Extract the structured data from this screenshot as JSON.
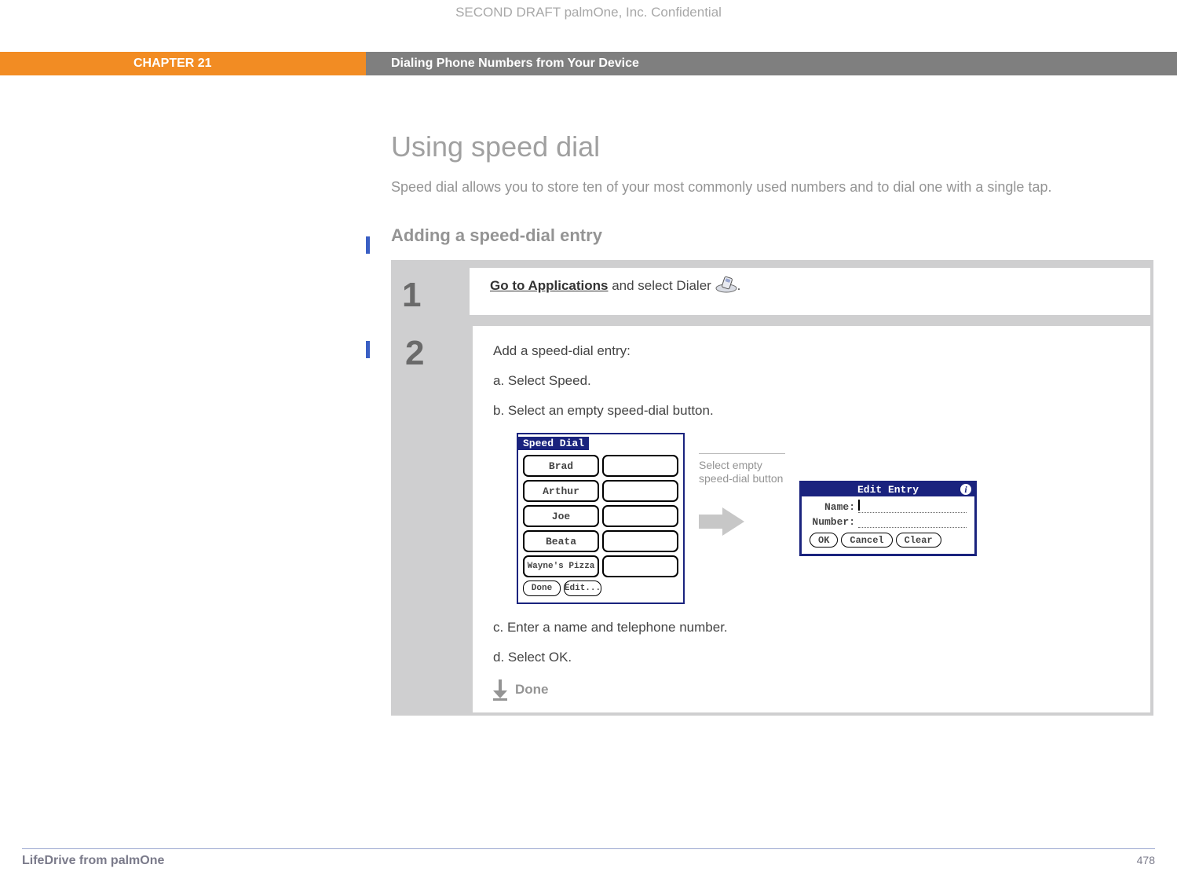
{
  "draft_notice": "SECOND DRAFT palmOne, Inc.  Confidential",
  "chapter": {
    "label": "CHAPTER 21",
    "title": "Dialing Phone Numbers from Your Device"
  },
  "section": {
    "heading": "Using speed dial",
    "intro": "Speed dial allows you to store ten of your most commonly used numbers and to dial one with a single tap.",
    "subheading": "Adding a speed-dial entry"
  },
  "steps": {
    "one": {
      "num": "1",
      "link_text": "Go to Applications",
      "rest": " and select Dialer ",
      "period": "."
    },
    "two": {
      "num": "2",
      "lead": "Add a speed-dial entry:",
      "a": "a.  Select Speed.",
      "b": "b.  Select an empty speed-dial button.",
      "c": "c.  Enter a name and telephone number.",
      "d": "d.  Select OK.",
      "done": "Done"
    }
  },
  "speed_dial": {
    "title": "Speed Dial",
    "entries": [
      "Brad",
      "Arthur",
      "Joe",
      "Beata",
      "Wayne's Pizza"
    ],
    "done_btn": "Done",
    "edit_btn": "Edit..."
  },
  "callout": {
    "line1": "Select empty",
    "line2": "speed-dial button"
  },
  "edit_entry": {
    "title": "Edit Entry",
    "name_label": "Name:",
    "number_label": "Number:",
    "ok": "OK",
    "cancel": "Cancel",
    "clear": "Clear"
  },
  "footer": {
    "product": "LifeDrive from palmOne",
    "page": "478"
  }
}
